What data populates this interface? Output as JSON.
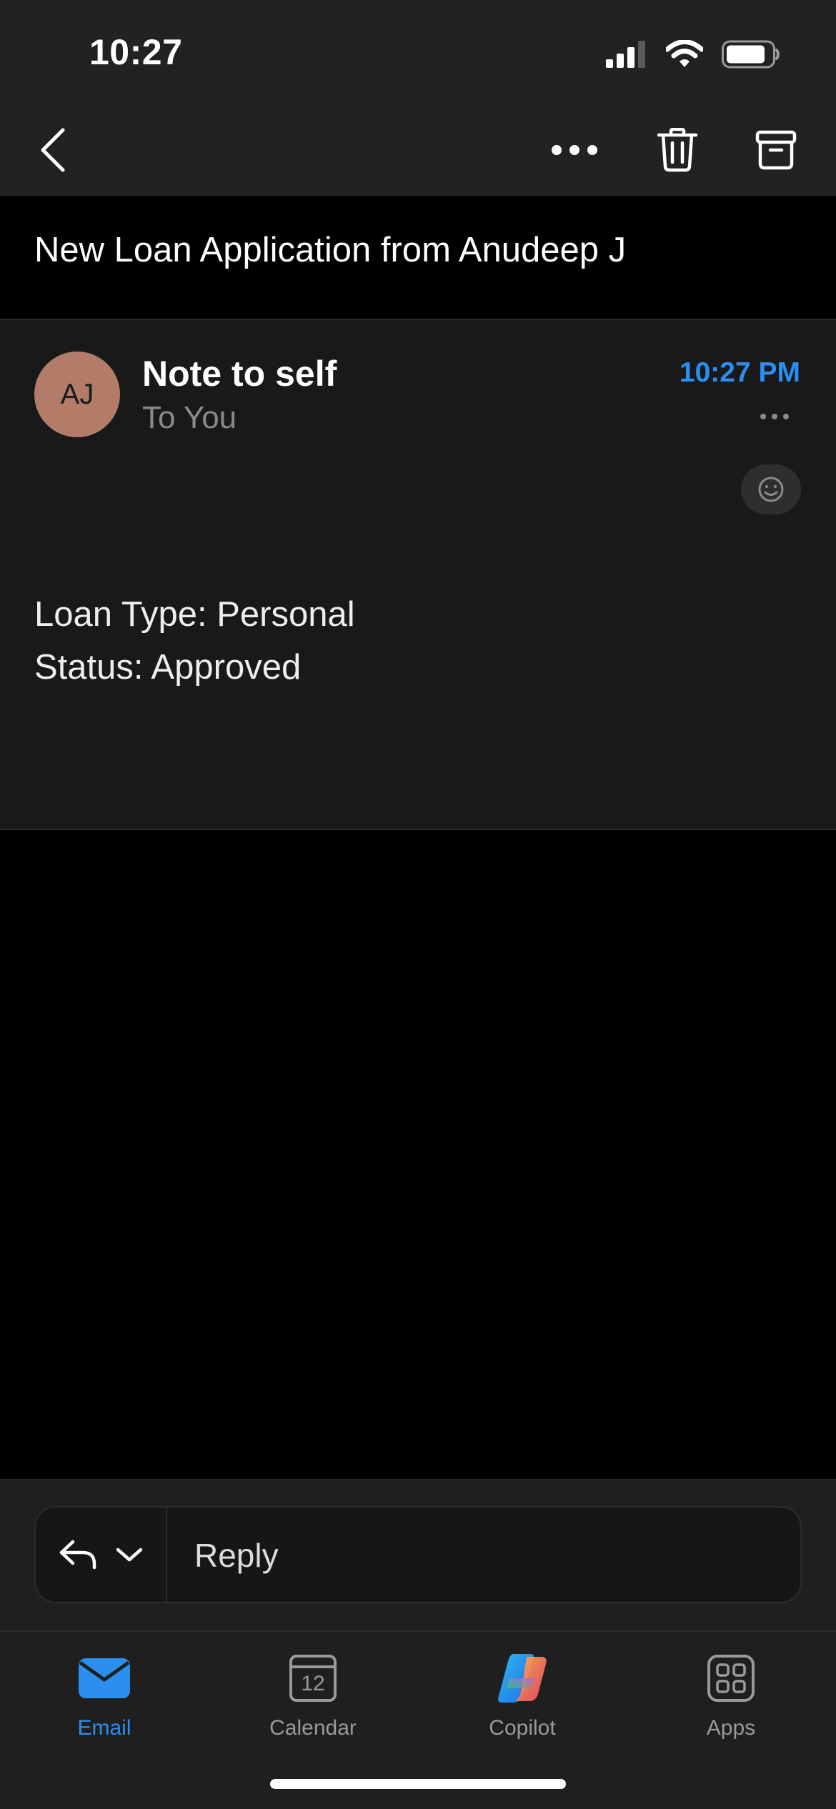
{
  "status_bar": {
    "time": "10:27",
    "icons": [
      "cellular-signal-icon",
      "wifi-icon",
      "battery-icon"
    ]
  },
  "toolbar": {
    "back": "chevron-left-icon",
    "more": "more-horizontal-icon",
    "delete": "trash-icon",
    "archive": "archive-icon"
  },
  "email": {
    "subject": "New Loan Application from Anudeep J",
    "avatar_initials": "AJ",
    "avatar_color": "#b27c68",
    "sender": "Note to self",
    "recipients": "To You",
    "time": "10:27 PM",
    "body_lines": [
      "Loan Type: Personal",
      "Status: Approved"
    ]
  },
  "reply": {
    "label": "Reply"
  },
  "tabs": [
    {
      "label": "Email",
      "icon": "mail-icon",
      "active": true
    },
    {
      "label": "Calendar",
      "icon": "calendar-icon",
      "day": "12",
      "active": false
    },
    {
      "label": "Copilot",
      "icon": "copilot-icon",
      "active": false
    },
    {
      "label": "Apps",
      "icon": "apps-grid-icon",
      "active": false
    }
  ],
  "colors": {
    "accent": "#2b8ff0",
    "toolbar_bg": "#222222",
    "card_bg": "#191919"
  }
}
